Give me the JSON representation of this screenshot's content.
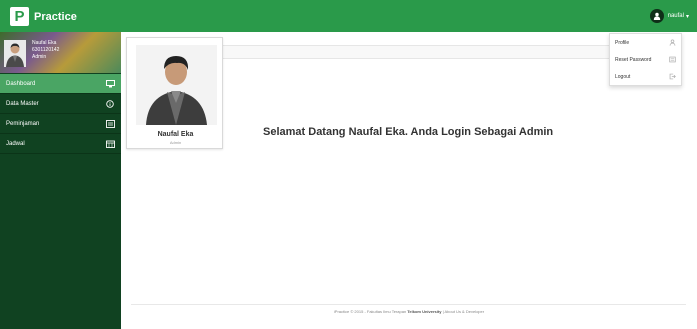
{
  "app": {
    "brand_letter": "P",
    "brand_name": "Practice"
  },
  "topbar": {
    "user_name": "naufal",
    "caret": "▾",
    "user_icon": "user-icon"
  },
  "sidebar": {
    "profile": {
      "name": "Naufal Eka",
      "id": "6301120142",
      "role": "Admin"
    },
    "items": [
      {
        "label": "Dashboard",
        "icon": "monitor-icon",
        "active": true
      },
      {
        "label": "Data Master",
        "icon": "info-circle-icon",
        "active": false
      },
      {
        "label": "Peminjaman",
        "icon": "list-icon",
        "active": false
      },
      {
        "label": "Jadwal",
        "icon": "calendar-icon",
        "active": false
      }
    ]
  },
  "card": {
    "name": "Naufal Eka",
    "role": "Admin"
  },
  "main": {
    "welcome": "Selamat Datang Naufal Eka. Anda Login Sebagai Admin"
  },
  "dropdown": {
    "items": [
      {
        "label": "Profile",
        "icon": "user-icon"
      },
      {
        "label": "Reset Password",
        "icon": "key-icon"
      },
      {
        "label": "Logout",
        "icon": "logout-icon"
      }
    ]
  },
  "footer": {
    "text_a": "iPractice © 2015 - Fakultas Ilmu Terapan ",
    "text_bold": "Telkom University",
    "text_b": " | About Us & Developer"
  },
  "colors": {
    "primary": "#2a9a4a",
    "sidebar": "#104221",
    "active": "#4aa564"
  }
}
